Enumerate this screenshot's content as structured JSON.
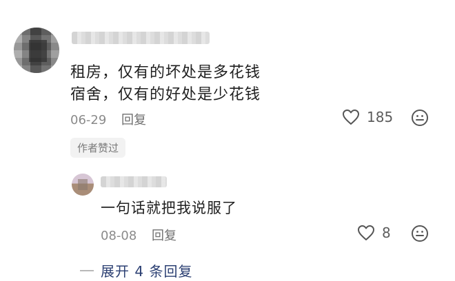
{
  "main_comment": {
    "lines": [
      "租房，仅有的坏处是多花钱",
      "宿舍，仅有的好处是少花钱"
    ],
    "date": "06-29",
    "reply_label": "回复",
    "likes": "185",
    "author_badge": "作者赞过"
  },
  "sub_comment": {
    "text": "一句话就把我说服了",
    "date": "08-08",
    "reply_label": "回复",
    "likes": "8"
  },
  "expand_replies": "展开 4 条回复",
  "icons": {
    "like": "heart-outline-icon",
    "reaction": "smiley-face-icon"
  },
  "colors": {
    "text": "#1f1f1f",
    "meta": "#8a8a8a",
    "link": "#2b3f72"
  }
}
